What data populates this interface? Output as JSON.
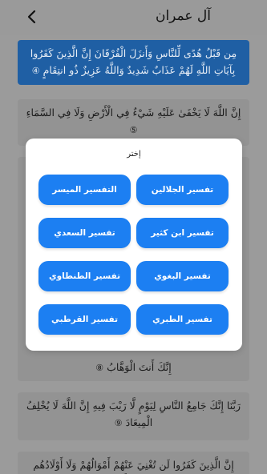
{
  "header": {
    "title": "آل عمران",
    "back_icon": "chevron-left-icon"
  },
  "verses": [
    {
      "text": "مِن قَبْلُ هُدًى لِّلنَّاسِ وَأَنزَلَ الْفُرْقَانَ إِنَّ الَّذِينَ كَفَرُوا بِآيَاتِ اللَّهِ لَهُمْ عَذَابٌ شَدِيدٌ وَاللَّهُ عَزِيزٌ ذُو انتِقَامٍ",
      "num": "④"
    },
    {
      "text": "إِنَّ اللَّهَ لَا يَخْفَىٰ عَلَيْهِ شَيْءٌ فِي الْأَرْضِ وَلَا فِي السَّمَاءِ",
      "num": "⑤"
    },
    {
      "text": "إِنَّكَ أَنتَ الْوَهَّابُ",
      "num": "⑧"
    },
    {
      "text": "رَبَّنَا إِنَّكَ جَامِعُ النَّاسِ لِيَوْمٍ لَّا رَيْبَ فِيهِ إِنَّ اللَّهَ لَا يُخْلِفُ الْمِيعَادَ",
      "num": "⑨"
    },
    {
      "text": "إِنَّ الَّذِينَ كَفَرُوا لَن تُغْنِيَ عَنْهُمْ أَمْوَالُهُمْ وَلَا أَوْلَادُهُم مِّنَ اللَّهِ",
      "num": ""
    }
  ],
  "dialog": {
    "title": "إختر",
    "options": [
      {
        "label": "تفسير الجلالين"
      },
      {
        "label": "التفسير الميسر"
      },
      {
        "label": "تفسير ابن كثير"
      },
      {
        "label": "تفسير السعدي"
      },
      {
        "label": "تفسير البغوي"
      },
      {
        "label": "تفسير الطنطاوي"
      },
      {
        "label": "تفسير الطبري"
      },
      {
        "label": "تفسير القرطبي"
      }
    ]
  },
  "colors": {
    "accent": "#1c7ff2",
    "active_verse": "#1f5fa4",
    "scrim_bg": "#9b9b9b"
  }
}
